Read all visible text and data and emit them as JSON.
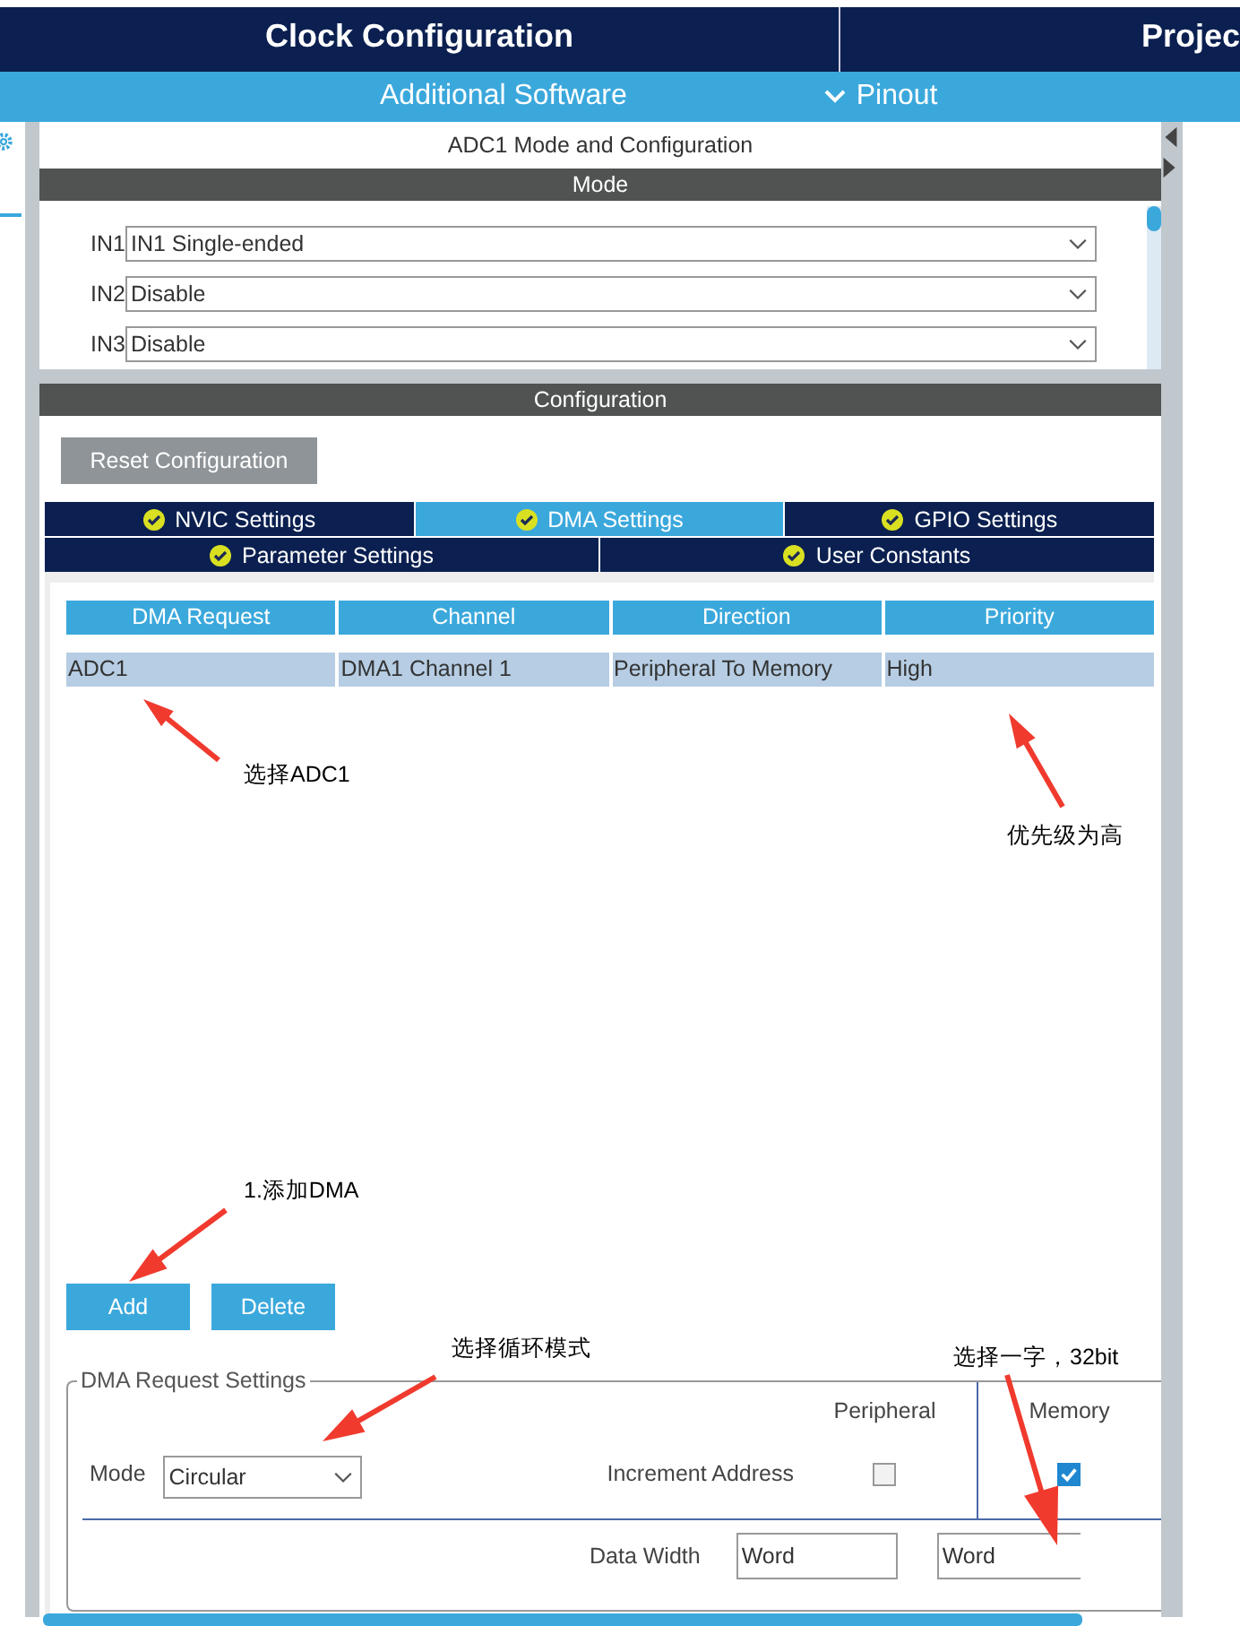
{
  "top_tabs": [
    {
      "label": "Clock Configuration"
    },
    {
      "label": "Projec"
    }
  ],
  "sub_bar": {
    "additional": "Additional Software",
    "pinout": "Pinout"
  },
  "panel_title": "ADC1 Mode and Configuration",
  "mode": {
    "header": "Mode",
    "rows": [
      {
        "label": "IN1",
        "value": "IN1 Single-ended"
      },
      {
        "label": "IN2",
        "value": "Disable"
      },
      {
        "label": "IN3",
        "value": "Disable"
      }
    ]
  },
  "configuration": {
    "header": "Configuration",
    "reset_button": "Reset Configuration",
    "tabs_row_1": [
      {
        "label": "NVIC Settings",
        "selected": false
      },
      {
        "label": "DMA Settings",
        "selected": true
      },
      {
        "label": "GPIO Settings",
        "selected": false
      }
    ],
    "tabs_row_2": [
      {
        "label": "Parameter Settings",
        "selected": false
      },
      {
        "label": "User Constants",
        "selected": false
      }
    ]
  },
  "table": {
    "columns": [
      "DMA Request",
      "Channel",
      "Direction",
      "Priority"
    ],
    "rows": [
      {
        "cells": [
          "ADC1",
          "DMA1 Channel 1",
          "Peripheral To Memory",
          "High"
        ],
        "selected": true
      }
    ]
  },
  "buttons": [
    "Add",
    "Delete"
  ],
  "request_settings": {
    "title": "DMA Request Settings",
    "mode_label": "Mode",
    "mode_value": "Circular",
    "peripheral": "Peripheral",
    "memory": "Memory",
    "increment_label": "Increment Address",
    "peripheral_increment": false,
    "memory_increment": true,
    "data_width_label": "Data Width",
    "peripheral_width": "Word",
    "memory_width": "Word"
  },
  "annotations": [
    "选择ADC1",
    "优先级为高",
    "1.添加DMA",
    "选择循环模式",
    "选择一字，32bit"
  ]
}
